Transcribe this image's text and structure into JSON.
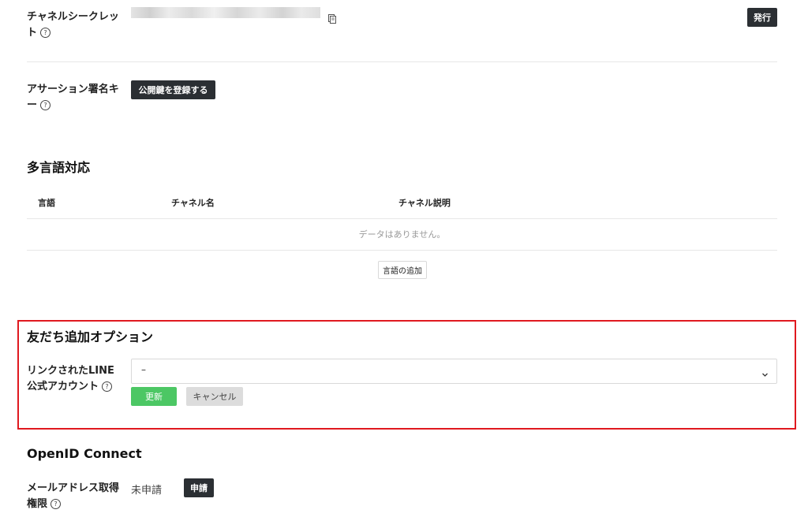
{
  "channel_secret": {
    "label_line1": "チャネルシークレッ",
    "label_line2": "ト",
    "help_icon": "?",
    "issue_button": "発行"
  },
  "assertion_key": {
    "label_line1": "アサーション署名キ",
    "label_line2": "ー",
    "help_icon": "?",
    "register_button": "公開鍵を登録する"
  },
  "multilang": {
    "title": "多言語対応",
    "columns": [
      "言語",
      "チャネル名",
      "チャネル説明"
    ],
    "empty_text": "データはありません。",
    "add_button": "言語の追加"
  },
  "friend_option": {
    "title": "友だち追加オプション",
    "label_line1": "リンクされたLINE",
    "label_line2": "公式アカウント",
    "help_icon": "?",
    "select_value": "–",
    "update_button": "更新",
    "cancel_button": "キャンセル",
    "highlight_color": "#e0191f"
  },
  "openid": {
    "title": "OpenID Connect",
    "email_label_line1": "メールアドレス取得",
    "email_label_line2": "権限",
    "help_icon": "?",
    "status": "未申請",
    "apply_button": "申請"
  }
}
